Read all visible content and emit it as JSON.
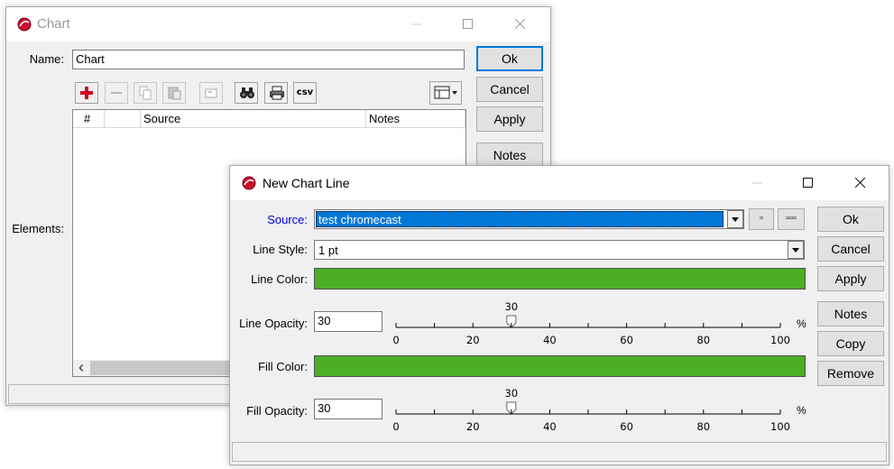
{
  "chart_window": {
    "title": "Chart",
    "name_label": "Name:",
    "name_value": "Chart",
    "elements_label": "Elements:",
    "columns": [
      "#",
      "",
      "Source",
      "Notes"
    ],
    "buttons": {
      "ok": "Ok",
      "cancel": "Cancel",
      "apply": "Apply",
      "notes": "Notes"
    },
    "toolbar": {
      "add": "plus-icon",
      "remove": "minus-icon",
      "copy": "copy-icon",
      "paste": "paste-icon",
      "frame": "frame-icon",
      "find": "binoculars-icon",
      "print": "printer-icon",
      "csv": "csv",
      "view": "view-menu-icon"
    },
    "scroll_left": "‹"
  },
  "line_window": {
    "title": "New Chart Line",
    "source_label": "Source:",
    "source_value": "test chromecast",
    "small_btn_1": "▫",
    "small_btn_2": "▫▫▫",
    "line_style_label": "Line Style:",
    "line_style_value": "1 pt",
    "line_color_label": "Line Color:",
    "line_color": "#4caf23",
    "line_opacity_label": "Line Opacity:",
    "line_opacity_value": "30",
    "line_opacity_slider": 30,
    "fill_color_label": "Fill Color:",
    "fill_color": "#4caf23",
    "fill_opacity_label": "Fill Opacity:",
    "fill_opacity_value": "30",
    "fill_opacity_slider": 30,
    "percent_sign": "%",
    "slider_ticks": [
      "0",
      "20",
      "40",
      "60",
      "80",
      "100"
    ],
    "buttons": {
      "ok": "Ok",
      "cancel": "Cancel",
      "apply": "Apply",
      "notes": "Notes",
      "copy": "Copy",
      "remove": "Remove"
    }
  },
  "colors": {
    "accent": "#0078d7",
    "selection": "#0078d7",
    "logo_red": "#c8102e"
  }
}
